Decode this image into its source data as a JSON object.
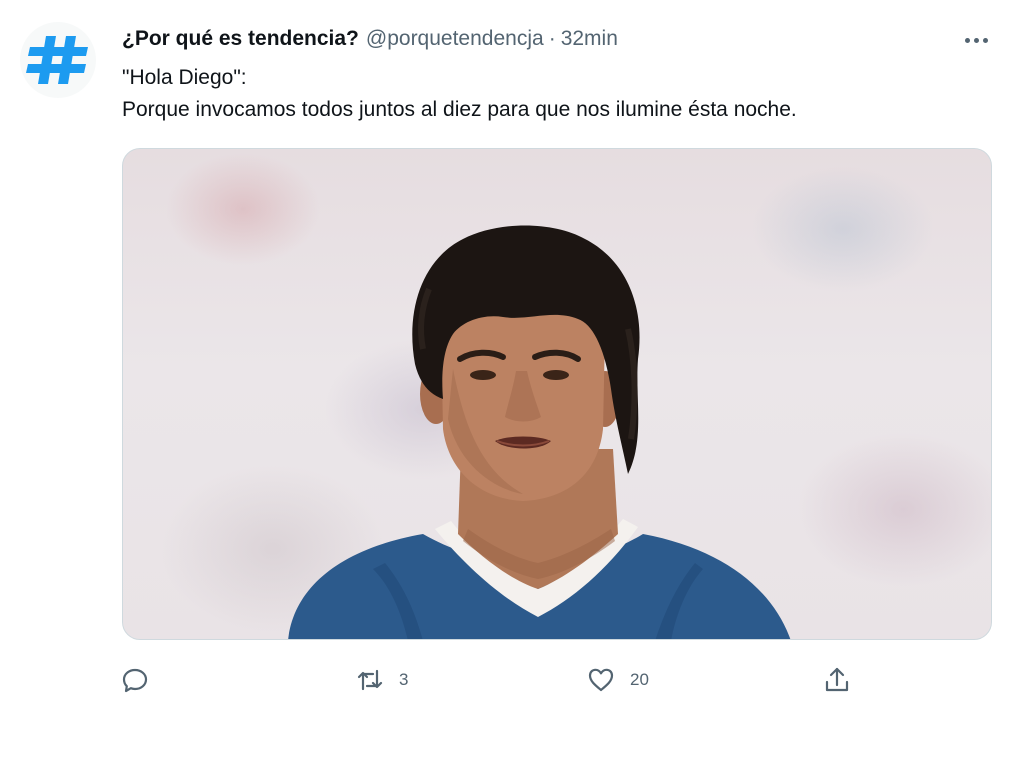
{
  "tweet": {
    "display_name": "¿Por qué es tendencia?",
    "handle": "@porquetendencja",
    "separator": "·",
    "timestamp": "32min",
    "text_line1": "\"Hola Diego\":",
    "text_line2": "Porque invocamos todos juntos al diez para que nos ilumine ésta noche.",
    "avatar_icon": "hashtag-icon",
    "avatar_color": "#1d9bf0",
    "media_icon": "player-photo"
  },
  "actions": {
    "reply": {
      "icon": "reply-icon",
      "count": ""
    },
    "retweet": {
      "icon": "retweet-icon",
      "count": "3"
    },
    "like": {
      "icon": "heart-icon",
      "count": "20"
    },
    "share": {
      "icon": "share-icon"
    }
  },
  "colors": {
    "text_primary": "#0f1419",
    "text_secondary": "#536471",
    "accent": "#1d9bf0"
  }
}
